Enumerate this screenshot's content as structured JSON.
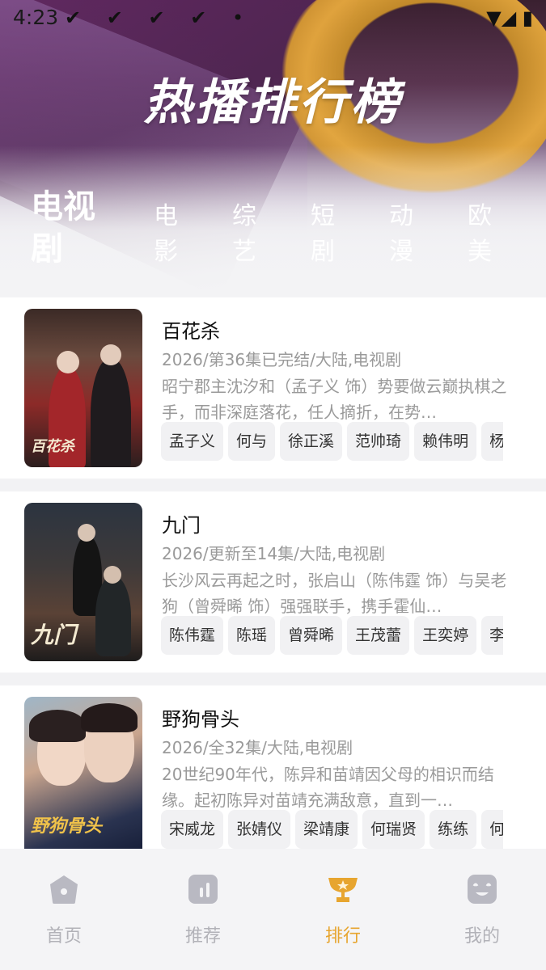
{
  "status_bar": {
    "time": "4:23",
    "notif_icons": "✔ ✔ ✔ ✔ •",
    "right_icons": "▼◢ ▮"
  },
  "header": {
    "title": "热播排行榜"
  },
  "tabs": [
    {
      "label": "电视剧",
      "active": true
    },
    {
      "label": "电影"
    },
    {
      "label": "综艺"
    },
    {
      "label": "短剧"
    },
    {
      "label": "动漫"
    },
    {
      "label": "欧美"
    }
  ],
  "items": [
    {
      "title": "百花杀",
      "meta": "2026/第36集已完结/大陆,电视剧",
      "desc": "昭宁郡主沈汐和（孟子义 饰）势要做云巅执棋之手，而非深庭落花，任人摘折，在势…",
      "poster_text": "百花杀",
      "cast": [
        "孟子义",
        "何与",
        "徐正溪",
        "范帅琦",
        "赖伟明",
        "杨"
      ]
    },
    {
      "title": "九门",
      "meta": "2026/更新至14集/大陆,电视剧",
      "desc": "长沙风云再起之时，张启山（陈伟霆 饰）与吴老狗（曾舜晞 饰）强强联手，携手霍仙…",
      "poster_text": "九门",
      "cast": [
        "陈伟霆",
        "陈瑶",
        "曾舜晞",
        "王茂蕾",
        "王奕婷",
        "李"
      ]
    },
    {
      "title": "野狗骨头",
      "meta": "2026/全32集/大陆,电视剧",
      "desc": "20世纪90年代，陈异和苗靖因父母的相识而结缘。起初陈异对苗靖充满敌意，直到一…",
      "poster_text": "野狗骨头",
      "cast": [
        "宋威龙",
        "张婧仪",
        "梁靖康",
        "何瑞贤",
        "练练",
        "何明翰"
      ]
    }
  ],
  "bottom_nav": [
    {
      "label": "首页",
      "icon": "home-icon"
    },
    {
      "label": "推荐",
      "icon": "chart-icon"
    },
    {
      "label": "排行",
      "icon": "trophy-icon",
      "active": true
    },
    {
      "label": "我的",
      "icon": "face-icon"
    }
  ],
  "colors": {
    "accent": "#e7a52f",
    "nav_inactive": "#b2b2b8",
    "meta_text": "#9a9a9a"
  }
}
